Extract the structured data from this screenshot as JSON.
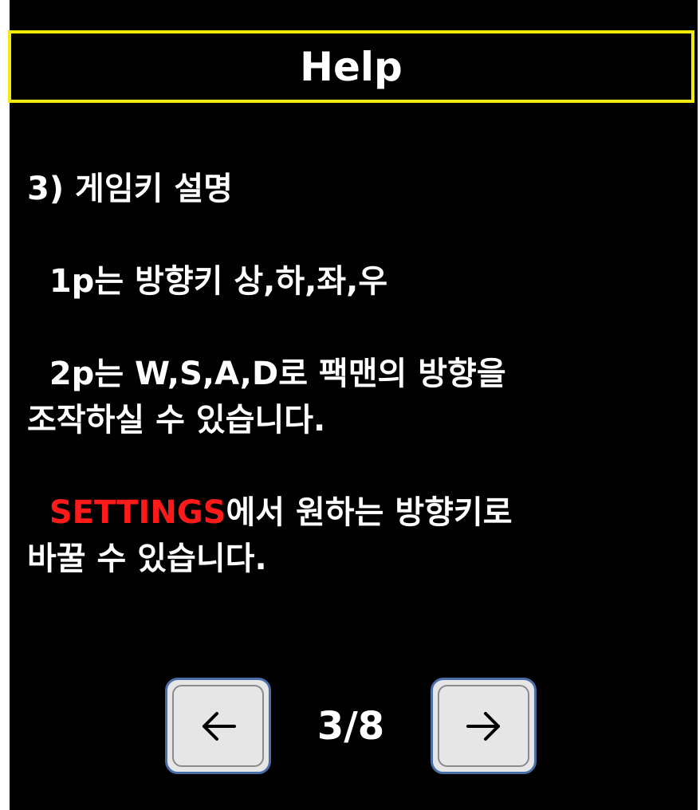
{
  "header": {
    "title": "Help"
  },
  "content": {
    "heading": "3) 게임키 설명",
    "p1": "  1p는 방향키 상,하,좌,우",
    "p2_line1": "  2p는 W,S,A,D로 팩맨의 방향을",
    "p2_line2": "조작하실 수 있습니다.",
    "p3_prefix": "  ",
    "p3_settings": "SETTINGS",
    "p3_line1_rest": "에서 원하는 방향키로",
    "p3_line2": "바꿀 수 있습니다."
  },
  "pagination": {
    "page": "3/8",
    "prev_icon": "arrow-left-icon",
    "next_icon": "arrow-right-icon"
  },
  "colors": {
    "background": "#000000",
    "title_border": "#f2ea0c",
    "text": "#ffffff",
    "accent": "#ff1a1a",
    "button_face": "#e6e6e6",
    "button_border": "#4a6fa8"
  }
}
